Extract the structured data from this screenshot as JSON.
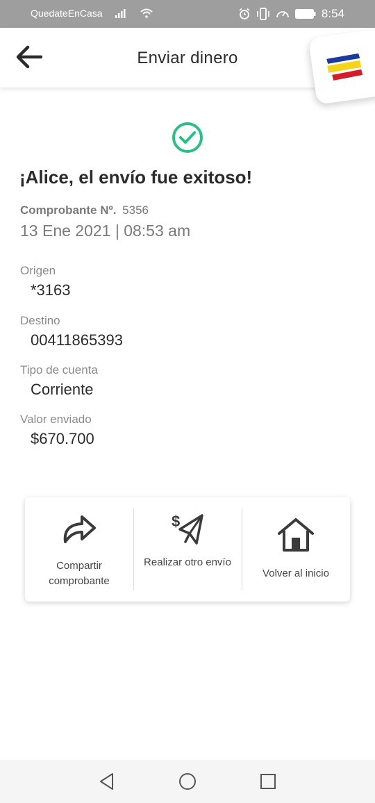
{
  "status_bar": {
    "carrier": "QuedateEnCasa",
    "time": "8:54"
  },
  "header": {
    "title": "Enviar dinero"
  },
  "colors": {
    "accent_green": "#2bbf86",
    "logo_blue": "#1b3b9c",
    "logo_yellow": "#f5d51c",
    "logo_red": "#d51c2b"
  },
  "success": {
    "title": "¡Alice, el envío fue exitoso!",
    "receipt_label": "Comprobante Nº.",
    "receipt_number": "5356",
    "datetime": "13 Ene 2021 | 08:53 am"
  },
  "details": {
    "origin_label": "Origen",
    "origin_value": "*3163",
    "destination_label": "Destino",
    "destination_value": "00411865393",
    "account_type_label": "Tipo de cuenta",
    "account_type_value": "Corriente",
    "amount_label": "Valor enviado",
    "amount_value": "$670.700"
  },
  "actions": {
    "share_label": "Compartir comprobante",
    "share_icon": "share-arrow-icon",
    "send_again_label": "Realizar otro envío",
    "send_again_icon": "money-plane-icon",
    "home_label": "Volver al inicio",
    "home_icon": "home-icon"
  }
}
